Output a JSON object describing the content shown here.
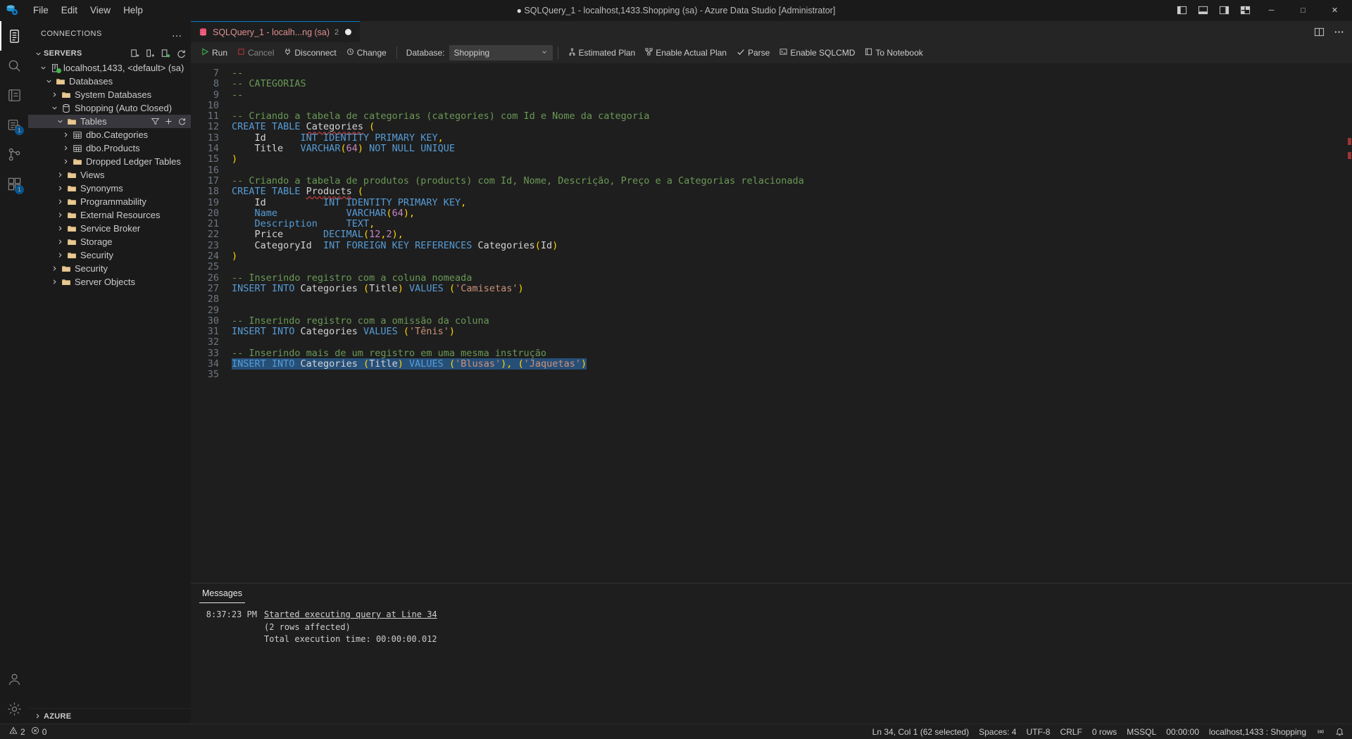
{
  "window": {
    "title_dot": "●",
    "title": "SQLQuery_1 - localhost,1433.Shopping (sa) - Azure Data Studio [Administrator]",
    "menus": [
      "File",
      "Edit",
      "View",
      "Help"
    ],
    "layout_buttons": [
      "toggle-primary-sidebar",
      "toggle-panel",
      "toggle-secondary-sidebar",
      "customize-layout"
    ],
    "controls": {
      "minimize": "─",
      "maximize": "□",
      "close": "✕"
    }
  },
  "activitybar": {
    "items": [
      {
        "name": "connections",
        "badge": ""
      },
      {
        "name": "search",
        "badge": ""
      },
      {
        "name": "notebooks",
        "badge": ""
      },
      {
        "name": "query-history",
        "badge": ""
      },
      {
        "name": "extensions-marketplace",
        "badge": "1"
      },
      {
        "name": "source-control",
        "badge": ""
      },
      {
        "name": "extensions",
        "badge": "1"
      }
    ],
    "bottom": [
      {
        "name": "accounts",
        "badge": ""
      },
      {
        "name": "manage-settings",
        "badge": ""
      }
    ]
  },
  "sidebar": {
    "header": "CONNECTIONS",
    "more": "…",
    "section": {
      "label": "SERVERS",
      "actions": [
        "new-connection",
        "new-server-group",
        "server-groups-view",
        "refresh"
      ]
    },
    "tree": [
      {
        "label": "localhost,1433, <default> (sa)",
        "depth": 1,
        "twisty": "down",
        "icon": "server",
        "selected": false
      },
      {
        "label": "Databases",
        "depth": 2,
        "twisty": "down",
        "icon": "folder",
        "selected": false
      },
      {
        "label": "System Databases",
        "depth": 3,
        "twisty": "right",
        "icon": "folder",
        "selected": false
      },
      {
        "label": "Shopping (Auto Closed)",
        "depth": 3,
        "twisty": "down",
        "icon": "database",
        "selected": false
      },
      {
        "label": "Tables",
        "depth": 4,
        "twisty": "down",
        "icon": "folder",
        "selected": true,
        "actions": [
          "filter",
          "add",
          "refresh"
        ]
      },
      {
        "label": "dbo.Categories",
        "depth": 5,
        "twisty": "right",
        "icon": "table",
        "selected": false
      },
      {
        "label": "dbo.Products",
        "depth": 5,
        "twisty": "right",
        "icon": "table",
        "selected": false
      },
      {
        "label": "Dropped Ledger Tables",
        "depth": 5,
        "twisty": "right",
        "icon": "folder",
        "selected": false
      },
      {
        "label": "Views",
        "depth": 4,
        "twisty": "right",
        "icon": "folder",
        "selected": false
      },
      {
        "label": "Synonyms",
        "depth": 4,
        "twisty": "right",
        "icon": "folder",
        "selected": false
      },
      {
        "label": "Programmability",
        "depth": 4,
        "twisty": "right",
        "icon": "folder",
        "selected": false
      },
      {
        "label": "External Resources",
        "depth": 4,
        "twisty": "right",
        "icon": "folder",
        "selected": false
      },
      {
        "label": "Service Broker",
        "depth": 4,
        "twisty": "right",
        "icon": "folder",
        "selected": false
      },
      {
        "label": "Storage",
        "depth": 4,
        "twisty": "right",
        "icon": "folder",
        "selected": false
      },
      {
        "label": "Security",
        "depth": 4,
        "twisty": "right",
        "icon": "folder",
        "selected": false
      },
      {
        "label": "Security",
        "depth": 3,
        "twisty": "right",
        "icon": "folder",
        "selected": false
      },
      {
        "label": "Server Objects",
        "depth": 3,
        "twisty": "right",
        "icon": "folder",
        "selected": false
      }
    ],
    "footer": "AZURE"
  },
  "tab": {
    "title": "SQLQuery_1 - localh...ng (sa)",
    "count": "2",
    "dirty": true,
    "actions": [
      "split-editor",
      "more-actions"
    ]
  },
  "toolbar": {
    "run": "Run",
    "cancel": "Cancel",
    "disconnect": "Disconnect",
    "change": "Change",
    "database_label": "Database:",
    "database_value": "Shopping",
    "estimated_plan": "Estimated Plan",
    "enable_actual_plan": "Enable Actual Plan",
    "parse": "Parse",
    "enable_sqlcmd": "Enable SQLCMD",
    "to_notebook": "To Notebook"
  },
  "editor": {
    "first_line": 7,
    "lines": [
      {
        "n": 7,
        "tokens": [
          {
            "t": "--",
            "c": "cm"
          }
        ]
      },
      {
        "n": 8,
        "tokens": [
          {
            "t": "-- CATEGORIAS",
            "c": "cm"
          }
        ]
      },
      {
        "n": 9,
        "tokens": [
          {
            "t": "--",
            "c": "cm"
          }
        ]
      },
      {
        "n": 10,
        "tokens": []
      },
      {
        "n": 11,
        "tokens": [
          {
            "t": "-- Criando a tabela de categorias (categories) com Id e Nome da categoria",
            "c": "cm"
          }
        ]
      },
      {
        "n": 12,
        "tokens": [
          {
            "t": "CREATE TABLE ",
            "c": "k"
          },
          {
            "t": "Categories",
            "c": "id sq"
          },
          {
            "t": " ",
            "c": "id"
          },
          {
            "t": "(",
            "c": "pn"
          }
        ]
      },
      {
        "n": 13,
        "tokens": [
          {
            "t": "    Id      ",
            "c": "id"
          },
          {
            "t": "INT IDENTITY PRIMARY KEY",
            "c": "k"
          },
          {
            "t": ",",
            "c": "pn"
          }
        ]
      },
      {
        "n": 14,
        "tokens": [
          {
            "t": "    Title   ",
            "c": "id"
          },
          {
            "t": "VARCHAR",
            "c": "k"
          },
          {
            "t": "(",
            "c": "pn"
          },
          {
            "t": "64",
            "c": "num"
          },
          {
            "t": ")",
            "c": "pn"
          },
          {
            "t": " NOT NULL UNIQUE",
            "c": "k"
          }
        ]
      },
      {
        "n": 15,
        "tokens": [
          {
            "t": ")",
            "c": "pn"
          }
        ]
      },
      {
        "n": 16,
        "tokens": []
      },
      {
        "n": 17,
        "tokens": [
          {
            "t": "-- Criando a tabela de produtos (products) com Id, Nome, Descrição, Preço e a Categorias relacionada",
            "c": "cm"
          }
        ]
      },
      {
        "n": 18,
        "tokens": [
          {
            "t": "CREATE TABLE ",
            "c": "k"
          },
          {
            "t": "Products",
            "c": "id sq"
          },
          {
            "t": " ",
            "c": "id"
          },
          {
            "t": "(",
            "c": "pn"
          }
        ]
      },
      {
        "n": 19,
        "tokens": [
          {
            "t": "    Id          ",
            "c": "id"
          },
          {
            "t": "INT IDENTITY PRIMARY KEY",
            "c": "k"
          },
          {
            "t": ",",
            "c": "pn"
          }
        ]
      },
      {
        "n": 20,
        "tokens": [
          {
            "t": "    ",
            "c": "id"
          },
          {
            "t": "Name",
            "c": "k"
          },
          {
            "t": "            ",
            "c": "id"
          },
          {
            "t": "VARCHAR",
            "c": "k"
          },
          {
            "t": "(",
            "c": "pn"
          },
          {
            "t": "64",
            "c": "num"
          },
          {
            "t": ")",
            "c": "pn"
          },
          {
            "t": ",",
            "c": "pn"
          }
        ]
      },
      {
        "n": 21,
        "tokens": [
          {
            "t": "    ",
            "c": "id"
          },
          {
            "t": "Description",
            "c": "k"
          },
          {
            "t": "     ",
            "c": "id"
          },
          {
            "t": "TEXT",
            "c": "k"
          },
          {
            "t": ",",
            "c": "pn"
          }
        ]
      },
      {
        "n": 22,
        "tokens": [
          {
            "t": "    Price       ",
            "c": "id"
          },
          {
            "t": "DECIMAL",
            "c": "k"
          },
          {
            "t": "(",
            "c": "pn"
          },
          {
            "t": "12",
            "c": "num"
          },
          {
            "t": ",",
            "c": "pn"
          },
          {
            "t": "2",
            "c": "num"
          },
          {
            "t": ")",
            "c": "pn"
          },
          {
            "t": ",",
            "c": "pn"
          }
        ]
      },
      {
        "n": 23,
        "tokens": [
          {
            "t": "    CategoryId  ",
            "c": "id"
          },
          {
            "t": "INT FOREIGN KEY REFERENCES",
            "c": "k"
          },
          {
            "t": " Categories",
            "c": "id"
          },
          {
            "t": "(",
            "c": "pn"
          },
          {
            "t": "Id",
            "c": "id"
          },
          {
            "t": ")",
            "c": "pn"
          }
        ]
      },
      {
        "n": 24,
        "tokens": [
          {
            "t": ")",
            "c": "pn"
          }
        ]
      },
      {
        "n": 25,
        "tokens": []
      },
      {
        "n": 26,
        "tokens": [
          {
            "t": "-- Inserindo registro com a coluna nomeada",
            "c": "cm"
          }
        ]
      },
      {
        "n": 27,
        "tokens": [
          {
            "t": "INSERT INTO ",
            "c": "k"
          },
          {
            "t": "Categories ",
            "c": "id"
          },
          {
            "t": "(",
            "c": "pn"
          },
          {
            "t": "Title",
            "c": "id"
          },
          {
            "t": ")",
            "c": "pn"
          },
          {
            "t": " ",
            "c": "id"
          },
          {
            "t": "VALUES",
            "c": "k"
          },
          {
            "t": " ",
            "c": "id"
          },
          {
            "t": "(",
            "c": "pn"
          },
          {
            "t": "'Camisetas'",
            "c": "str"
          },
          {
            "t": ")",
            "c": "pn"
          }
        ]
      },
      {
        "n": 28,
        "tokens": []
      },
      {
        "n": 29,
        "tokens": []
      },
      {
        "n": 30,
        "tokens": [
          {
            "t": "-- Inserindo registro com a omissão da coluna",
            "c": "cm"
          }
        ]
      },
      {
        "n": 31,
        "tokens": [
          {
            "t": "INSERT INTO ",
            "c": "k"
          },
          {
            "t": "Categories ",
            "c": "id"
          },
          {
            "t": "VALUES",
            "c": "k"
          },
          {
            "t": " ",
            "c": "id"
          },
          {
            "t": "(",
            "c": "pn"
          },
          {
            "t": "'Tênis'",
            "c": "str"
          },
          {
            "t": ")",
            "c": "pn"
          }
        ]
      },
      {
        "n": 32,
        "tokens": []
      },
      {
        "n": 33,
        "tokens": [
          {
            "t": "-- Inserindo mais de um registro em uma mesma instrução",
            "c": "cm"
          }
        ]
      },
      {
        "n": 34,
        "selected": true,
        "tokens": [
          {
            "t": "INSERT INTO ",
            "c": "k"
          },
          {
            "t": "Categories ",
            "c": "id"
          },
          {
            "t": "(",
            "c": "pn"
          },
          {
            "t": "Title",
            "c": "id"
          },
          {
            "t": ")",
            "c": "pn"
          },
          {
            "t": " ",
            "c": "id"
          },
          {
            "t": "VALUES",
            "c": "k"
          },
          {
            "t": " ",
            "c": "id"
          },
          {
            "t": "(",
            "c": "pn"
          },
          {
            "t": "'Blusas'",
            "c": "str"
          },
          {
            "t": ")",
            "c": "pn"
          },
          {
            "t": ",",
            "c": "pn"
          },
          {
            "t": " ",
            "c": "id"
          },
          {
            "t": "(",
            "c": "pn"
          },
          {
            "t": "'Jaquetas'",
            "c": "str"
          },
          {
            "t": ")",
            "c": "pn"
          }
        ]
      },
      {
        "n": 35,
        "tokens": []
      }
    ]
  },
  "panel": {
    "tab": "Messages",
    "messages": [
      {
        "time": "8:37:23 PM",
        "text": "Started executing query at Line 34",
        "link": true
      },
      {
        "time": "",
        "text": "(2 rows affected)",
        "link": false
      },
      {
        "time": "",
        "text": "Total execution time: 00:00:00.012",
        "link": false
      }
    ]
  },
  "statusbar": {
    "problems": {
      "warnings": "2",
      "errors": "0"
    },
    "right": [
      {
        "name": "cursor-position",
        "text": "Ln 34, Col 1 (62 selected)"
      },
      {
        "name": "indentation",
        "text": "Spaces: 4"
      },
      {
        "name": "encoding",
        "text": "UTF-8"
      },
      {
        "name": "eol",
        "text": "CRLF"
      },
      {
        "name": "row-count",
        "text": "0 rows"
      },
      {
        "name": "language-mode",
        "text": "MSSQL"
      },
      {
        "name": "execution-time",
        "text": "00:00:00"
      },
      {
        "name": "connection",
        "text": "localhost,1433 : Shopping"
      }
    ],
    "icons": [
      "broadcast-icon",
      "bell-icon"
    ]
  },
  "colors": {
    "accent": "#007acc",
    "tab_text": "#e08f8f",
    "keyword": "#569cd6",
    "comment": "#6a9955",
    "string": "#ce9178",
    "number": "#c586c0",
    "paren": "#ffd700",
    "selection": "#264f78",
    "badge": "#0078d4",
    "connected": "#3fb950"
  }
}
